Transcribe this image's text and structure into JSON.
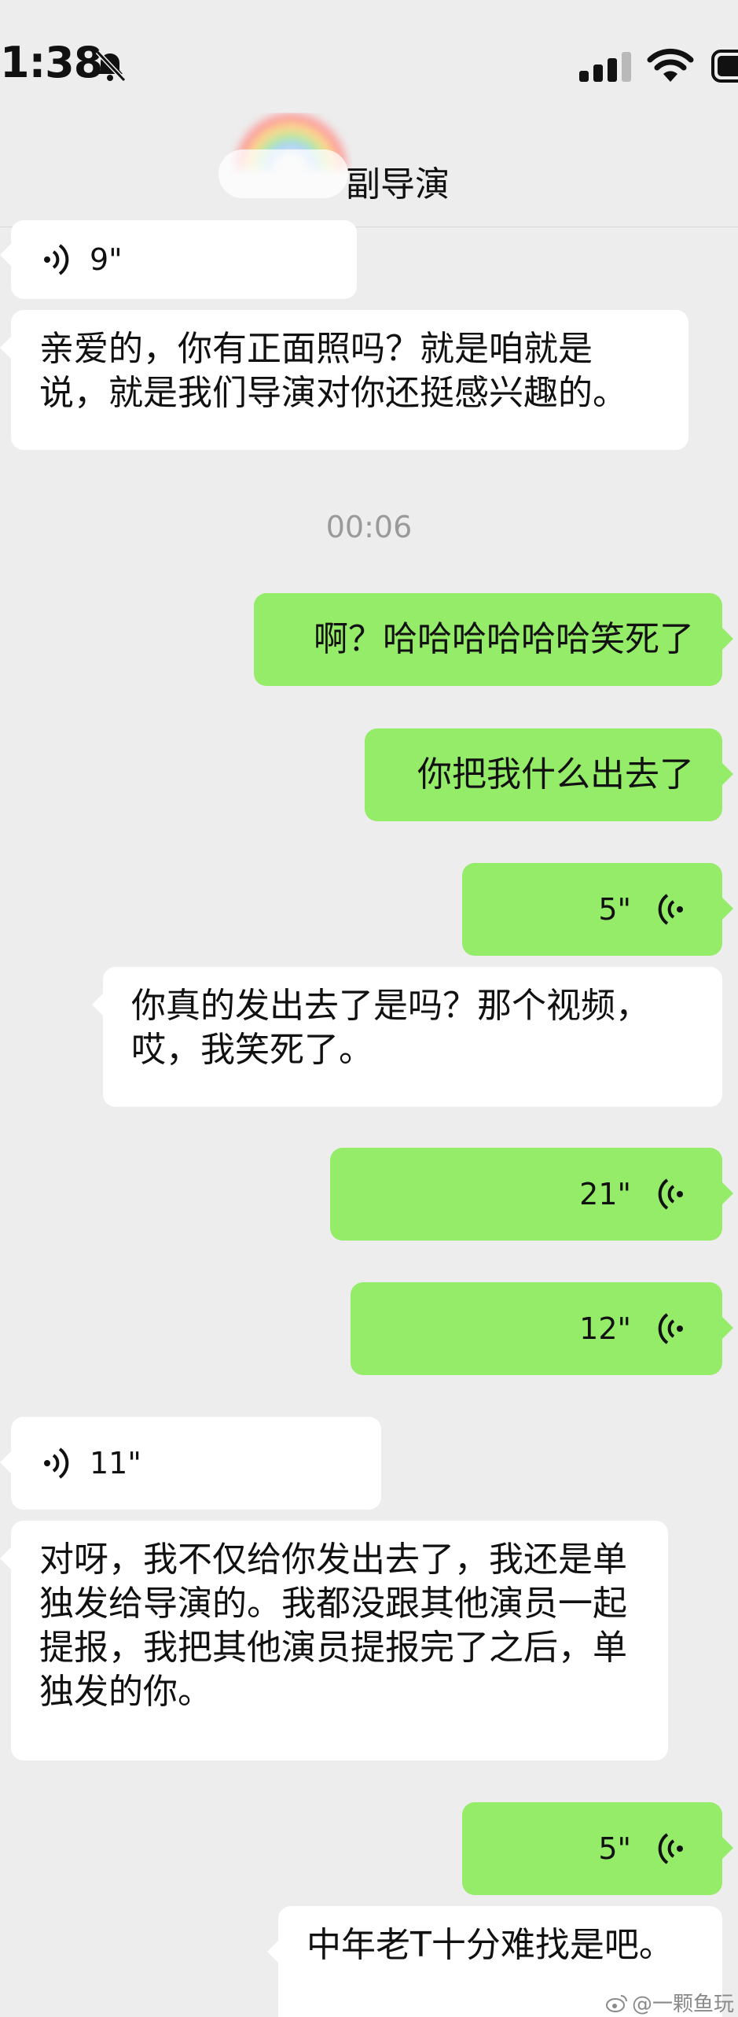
{
  "status_bar": {
    "time": "1:38"
  },
  "nav": {
    "title": "副导演"
  },
  "messages": {
    "voice_in_1": {
      "duration": "9\""
    },
    "text_in_1": {
      "text": "亲爱的，你有正面照吗？就是咱就是说，就是我们导演对你还挺感兴趣的。"
    },
    "timestamp": "00:06",
    "text_out_1": {
      "text": "啊？哈哈哈哈哈哈笑死了"
    },
    "text_out_2": {
      "text": "你把我什么出去了"
    },
    "voice_out_1": {
      "duration": "5\""
    },
    "text_in_2": {
      "text": "你真的发出去了是吗？那个视频，哎，我笑死了。"
    },
    "voice_out_2": {
      "duration": "21\""
    },
    "voice_out_3": {
      "duration": "12\""
    },
    "voice_in_2": {
      "duration": "11\""
    },
    "text_in_3": {
      "text": "对呀，我不仅给你发出去了，我还是单独发给导演的。我都没跟其他演员一起提报，我把其他演员提报完了之后，单独发的你。"
    },
    "voice_out_4": {
      "duration": "5\""
    },
    "text_in_4": {
      "text": "中年老T十分难找是吧。"
    }
  },
  "watermark": {
    "text": "@一颗鱼玩"
  },
  "colors": {
    "background": "#ededed",
    "incoming": "#ffffff",
    "outgoing": "#95ec69"
  },
  "icons": [
    "bell-slash-icon",
    "signal-icon",
    "wifi-icon",
    "battery-icon",
    "voice-wave-icon",
    "weibo-icon"
  ]
}
